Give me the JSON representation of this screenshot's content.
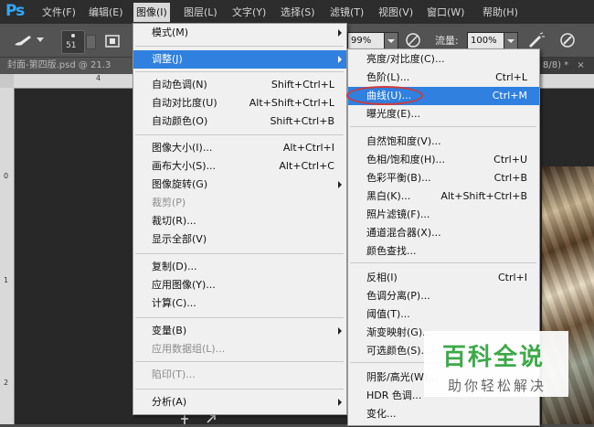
{
  "app": {
    "logo": "Ps"
  },
  "menubar": {
    "items": [
      "文件(F)",
      "编辑(E)",
      "图像(I)",
      "图层(L)",
      "文字(Y)",
      "选择(S)",
      "滤镜(T)",
      "视图(V)",
      "窗口(W)",
      "帮助(H)"
    ]
  },
  "options": {
    "brush_size": "51",
    "opacity_value": "99%",
    "flow_label": "流量:",
    "flow_value": "100%"
  },
  "document": {
    "tab_title": "封面-第四版.psd @ 21.3",
    "tab_suffix": "8/8) *",
    "tab_close": "×"
  },
  "rulers": {
    "h_marks": [
      "4"
    ],
    "v_marks": [
      "0",
      "1",
      "2"
    ]
  },
  "image_menu": {
    "items": [
      {
        "label": "模式(M)",
        "shortcut": "",
        "submenu": true,
        "disabled": false
      },
      {
        "label": "调整(J)",
        "shortcut": "",
        "submenu": true,
        "disabled": false,
        "highlight": true
      },
      {
        "label": "自动色调(N)",
        "shortcut": "Shift+Ctrl+L",
        "submenu": false,
        "disabled": false
      },
      {
        "label": "自动对比度(U)",
        "shortcut": "Alt+Shift+Ctrl+L",
        "submenu": false,
        "disabled": false
      },
      {
        "label": "自动颜色(O)",
        "shortcut": "Shift+Ctrl+B",
        "submenu": false,
        "disabled": false
      },
      {
        "label": "图像大小(I)...",
        "shortcut": "Alt+Ctrl+I",
        "submenu": false,
        "disabled": false
      },
      {
        "label": "画布大小(S)...",
        "shortcut": "Alt+Ctrl+C",
        "submenu": false,
        "disabled": false
      },
      {
        "label": "图像旋转(G)",
        "shortcut": "",
        "submenu": true,
        "disabled": false
      },
      {
        "label": "裁剪(P)",
        "shortcut": "",
        "submenu": false,
        "disabled": true
      },
      {
        "label": "裁切(R)...",
        "shortcut": "",
        "submenu": false,
        "disabled": false
      },
      {
        "label": "显示全部(V)",
        "shortcut": "",
        "submenu": false,
        "disabled": false
      },
      {
        "label": "复制(D)...",
        "shortcut": "",
        "submenu": false,
        "disabled": false
      },
      {
        "label": "应用图像(Y)...",
        "shortcut": "",
        "submenu": false,
        "disabled": false
      },
      {
        "label": "计算(C)...",
        "shortcut": "",
        "submenu": false,
        "disabled": false
      },
      {
        "label": "变量(B)",
        "shortcut": "",
        "submenu": true,
        "disabled": false
      },
      {
        "label": "应用数据组(L)...",
        "shortcut": "",
        "submenu": false,
        "disabled": true
      },
      {
        "label": "陷印(T)...",
        "shortcut": "",
        "submenu": false,
        "disabled": true
      },
      {
        "label": "分析(A)",
        "shortcut": "",
        "submenu": true,
        "disabled": false
      }
    ]
  },
  "adjust_menu": {
    "items": [
      {
        "label": "亮度/对比度(C)...",
        "shortcut": ""
      },
      {
        "label": "色阶(L)...",
        "shortcut": "Ctrl+L"
      },
      {
        "label": "曲线(U)...",
        "shortcut": "Ctrl+M",
        "highlight": true
      },
      {
        "label": "曝光度(E)...",
        "shortcut": ""
      },
      {
        "label": "自然饱和度(V)...",
        "shortcut": ""
      },
      {
        "label": "色相/饱和度(H)...",
        "shortcut": "Ctrl+U"
      },
      {
        "label": "色彩平衡(B)...",
        "shortcut": "Ctrl+B"
      },
      {
        "label": "黑白(K)...",
        "shortcut": "Alt+Shift+Ctrl+B"
      },
      {
        "label": "照片滤镜(F)...",
        "shortcut": ""
      },
      {
        "label": "通道混合器(X)...",
        "shortcut": ""
      },
      {
        "label": "颜色查找...",
        "shortcut": ""
      },
      {
        "label": "反相(I)",
        "shortcut": "Ctrl+I"
      },
      {
        "label": "色调分离(P)...",
        "shortcut": ""
      },
      {
        "label": "阈值(T)...",
        "shortcut": ""
      },
      {
        "label": "渐变映射(G)...",
        "shortcut": ""
      },
      {
        "label": "可选颜色(S)...",
        "shortcut": ""
      },
      {
        "label": "阴影/高光(W)...",
        "shortcut": ""
      },
      {
        "label": "HDR 色调...",
        "shortcut": ""
      },
      {
        "label": "变化...",
        "shortcut": ""
      }
    ]
  },
  "watermark": {
    "title": "百科全说",
    "subtitle": "助你轻松解决"
  },
  "colors": {
    "menu_highlight": "#2f80df",
    "annotation_ring": "#d03a3a",
    "watermark_green": "#3ea94a"
  }
}
